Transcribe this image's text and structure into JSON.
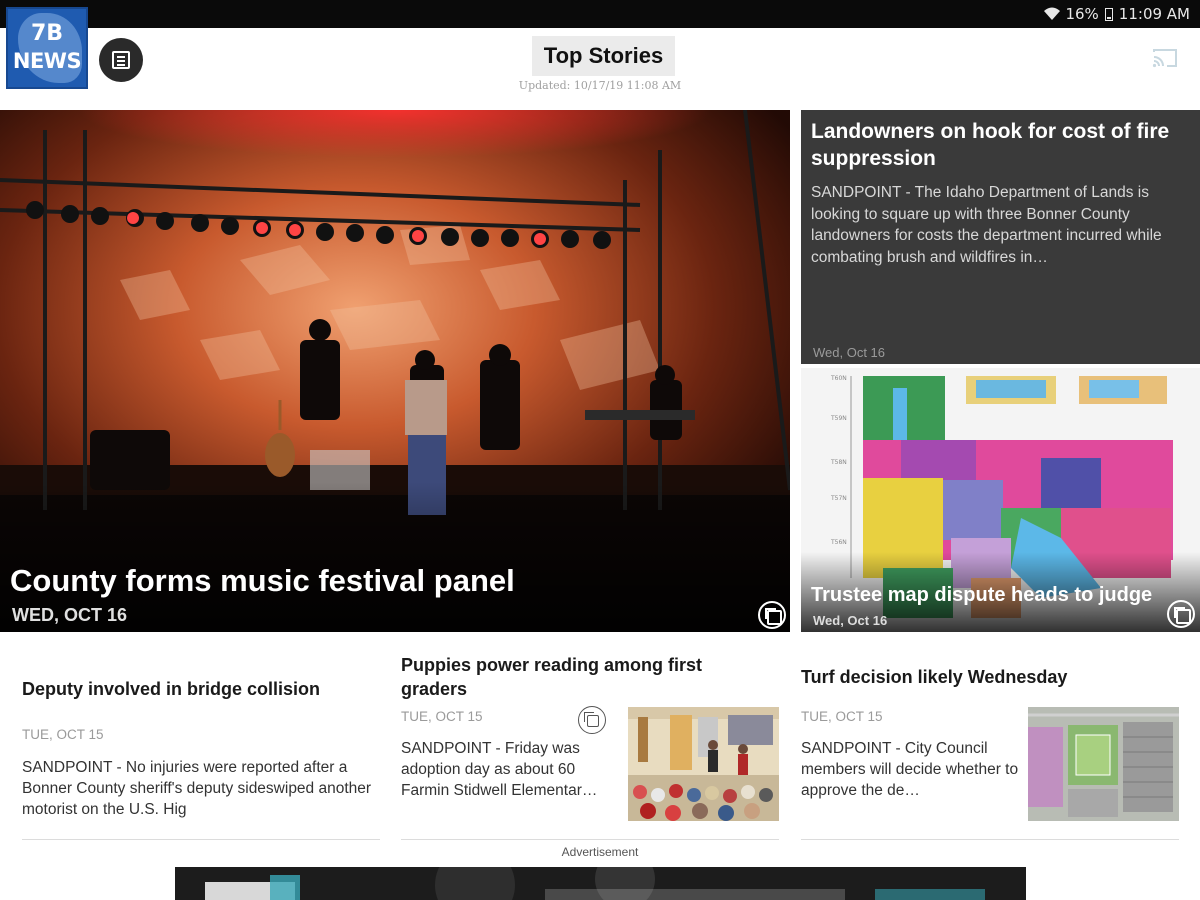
{
  "status_bar": {
    "battery": "16%",
    "time": "11:09 AM"
  },
  "app": {
    "logo_line1": "7B",
    "logo_line2": "NEWS",
    "title": "Top Stories",
    "updated": "Updated: 10/17/19 11:08 AM"
  },
  "hero": {
    "headline": "County forms music festival panel",
    "date": "WED, OCT 16"
  },
  "right_top": {
    "headline": "Landowners on hook for cost of fire suppression",
    "summary": "SANDPOINT - The Idaho Department of Lands is looking to square up with three Bonner County landowners for costs the department incurred while combating brush and wildfires in…",
    "date": "Wed, Oct 16"
  },
  "right_map": {
    "headline": "Trustee map dispute heads to judge",
    "date": "Wed, Oct 16"
  },
  "stories": [
    {
      "headline": "Deputy involved in bridge collision",
      "date": "TUE, OCT 15",
      "summary": "SANDPOINT - No injuries were reported after a Bonner County sheriff's deputy sideswiped another motorist on the U.S. Hig"
    },
    {
      "headline": "Puppies power reading among first graders",
      "date": "TUE, OCT 15",
      "summary": "SANDPOINT - Friday was adoption day as about 60 Farmin Stidwell Elementar…"
    },
    {
      "headline": "Turf decision likely Wednesday",
      "date": "TUE, OCT 15",
      "summary": "SANDPOINT - City Council members will decide whether to approve the de…"
    }
  ],
  "advertisement_label": "Advertisement",
  "colors": {
    "logo_blue": "#1f5bb0",
    "status_bar": "#0a0a0a",
    "card_dark": "#3a3a3a"
  }
}
